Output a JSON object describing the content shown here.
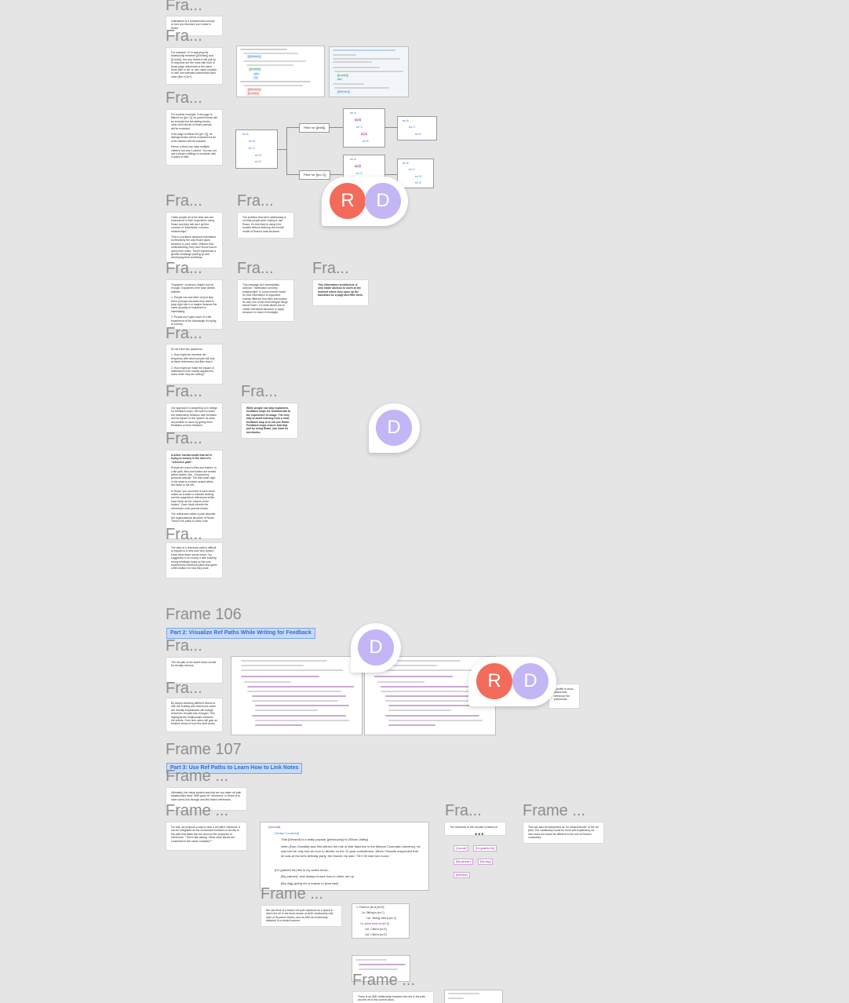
{
  "frame_labels": [
    "Fra...",
    "Fra...",
    "Fra...",
    "Fra...",
    "Fra...",
    "Fra...",
    "Fra...",
    "Fra...",
    "Fra...",
    "Fra...",
    "Fra...",
    "Fra...",
    "Fra...",
    "Frame 106",
    "Fra...",
    "Fra...",
    "Frame 107",
    "Frame ...",
    "Frame ...",
    "Fra...",
    "Frame ...",
    "Frame ...",
    "Frame ..."
  ],
  "banners": {
    "part2": "Part 2: Visualize Ref Paths While Writing for Feedback",
    "part3": "Part 3: Use Ref Paths to Learn How to Link Notes"
  },
  "avatars": {
    "r": "R",
    "d": "D"
  },
  "colors": {
    "avatar_r": "#f26b5b",
    "avatar_d": "#c4b5f5",
    "accent": "#2a7fd4",
    "banner_bg": "#c7daf6"
  },
  "cards": {
    "c1": "Indentation is a fundamental concept to how you structure your notes in Roam.",
    "c2": "For example, if I'm querying the relationship between [[Kitchen]] and [[Lunch]], the only results it will pull up in response are the ones with both of those page references in the same block (like in 'ab' or 'abc' style) notation or with one indented underneath each other (like in 2a+).",
    "c3a": "For another example, if the page is filtered for [[ex C]], its parent blocks will be included but the sibling blocks - other child blocks of those parents - will be excluded.",
    "c3b": "If the page is filtered for [[ex C]], its siblings blocks will be excluded but all of its children will be included.",
    "c3c": "Hence a block can have multiple children but only 1 parent. You can not use a block's siblings to conclude with a query or filter.",
    "c4a": "I think people all of the time who are enamoured in their experience using Roam and they still don't get the concept of \"indentation conveys relationships\".",
    "c4b": "This is a problem because indentation is effectively the way Roam gives structure to your notes. Without that understanding, they won't know how to query their notes. They'll experience a greater challenge picking up and developing their workflows.",
    "c5": "The problem that we're addressing is not that people aren't trying to use Roam. It's that they're using it for months without learning the mental model of Roam's data structure.",
    "c6a": "\"Explainer\" content is helpful but not enough. Explainers here have limited abilities:",
    "c6b": "1. People can and often do just skip them; perhaps because they want to jump right into it or maybe because the sheer quantity of explainers is intimidating.",
    "c6c": "2. People don't gain much of a felt experience of the knowledge it's trying to convey.",
    "c7": "This message isn't immediately obvious: \"Indentation conveys relationships\" is a new mental model for how information is organized, entirely different from files and folders. It's also one of the most integral things about Roam - it's what allows you to create intentional structure or apply structure to chaos in hindsight.",
    "c8": "This information architecture is only made obvious to users at the moment where they open up the backlinks for a page and filter them.",
    "c9a": "So we have two questions:",
    "c9b": "1. How might we increase the frequency with which people will look at these references and filter them?",
    "c9c": "2. How might we make the impact of indentation more readily apparent to users while they are writing?",
    "c10": "Our approach to answering is to design for feedback loops. We want to make the relationship between user behavior and its impact on the system as clear as possible to users by giving them feedback on their behavior.",
    "c11": "While people can skip explainers, feedback loops are fundamental to the experience of usage. The only way to avoid learning from a clear feedback loop is to not use Roam. Feedback loops ensure that that, just by using Roam, you learn its mechanics.",
    "c12a": "A better mental model that we're trying to convey is the idea of a \"reference path\".",
    "c12b": "People are used to files and folders. In a file path, files and folders are nested within folders, like ../Dropbox/my personal website. The last folder right of the slash is a folder nested within the folder to the left.",
    "c12c": "In Roam, you can think of each block indent as a slash to indicate nesting, and the page/block references within each block as the \"names of the folders\". Each block inherits the references of its parents blocks.",
    "c12d": "The references within a path describe the organizational structure of Roam. They're the paths to every note.",
    "c13": "The idea of a reference path is difficult to explain to a new user who doesn't know what these words mean. Our suggestion is to convey it with building strong feedback loops so the user experiences reference paths and gains a felt intuition for how they work.",
    "c14": "The ref path of the active block should be visually obvious.",
    "c15a": "An example of implementing this would be changing the color and bolding all block/page references in the ref path of the active block.",
    "c16": "By simply selecting different blocks to edit, the bolding and references which are visually emphasized will change whenever ref path has changed. This highlights the relationships between the bullets. Over time users will gain an intuitive sense of how this stuff works.",
    "c17": "Ultimately, the visual system was that we can make ref path relationships clear. With good ref \"structures\" in Roam is to have users look through and find linked references.",
    "c18": "For this, we propose a way to view a ref path's mentions. It can be integrated as the unmanned members of all refs in the path that takes into the account the sequence of references. \"This is like asking, 'What other blocks are connected to the same concepts?'\"",
    "c19": "The mechanic of the ref path is based on",
    "c20": "This can also be interpreted as \"bo related blocks\" of the ref path. The vocabulary would be more self-explanatory for new users but would be different to the rest of Roam's vocabulary.",
    "c21": "We can think of a block's ref path mentions as a space in which the ref in the block shows us AND relationship with each of its parent blocks, and as AND-ed exclusively attached in a nested manner.",
    "c22": "There is an AND relationship between the refs in the path and the ref in the current block.",
    "c23": "...profile to show blocks that reference the parent that..."
  },
  "diagram": {
    "filter_a": "Filter for [[exB]]",
    "filter_b": "Filter for [[ex C]]",
    "root": [
      "ex A",
      "ex B",
      "ex C",
      "ex D",
      "ex E"
    ],
    "b_top": [
      "ex A",
      "ex B",
      "ex C",
      "ex D",
      "ex E"
    ],
    "b_side": [
      "ex A",
      "ex C",
      "ex E"
    ],
    "c_top": [
      "ex A",
      "ex B",
      "ex C"
    ],
    "c_side": [
      "ex A",
      "ex C",
      "ex D",
      "ex E"
    ]
  },
  "journal": {
    "title": "[Journal]",
    "line1": "[Today I Learned]",
    "line2a": "That [Dessert] is a really popular [philosophy] in [Silicon Valley]",
    "line2b": "when [Dan Chaddle] was first offered the role of War Machine in the [Marvel Cinematic Universe], he was told he only had an hour to decide on the 12-year commitment. When Cheadle responded that he was at his kid's birthday party, the Marvel rep said, \"Oh! Oh take two hours.\"",
    "line3": "[I'm grateful for] this is my active block...",
    "line4": "[My partner], who always knows how to cheer me up",
    "line5": "[My dog] giving me a reason to [exercise]"
  },
  "ref_chips": [
    "[Journal]",
    "[I'm grateful for]",
    "[My partner]",
    "[My dog]",
    "[exercise]"
  ],
  "tree_nodes": [
    "1. Parent in [ex A] [ex B]",
    "1a. Sibling to [ex C]",
    "1a1. Sibling child to [ex C]",
    "1b. Active block for [ex D]",
    "1b1. Child in [ex E]",
    "1b2. Child in [ex E]"
  ]
}
